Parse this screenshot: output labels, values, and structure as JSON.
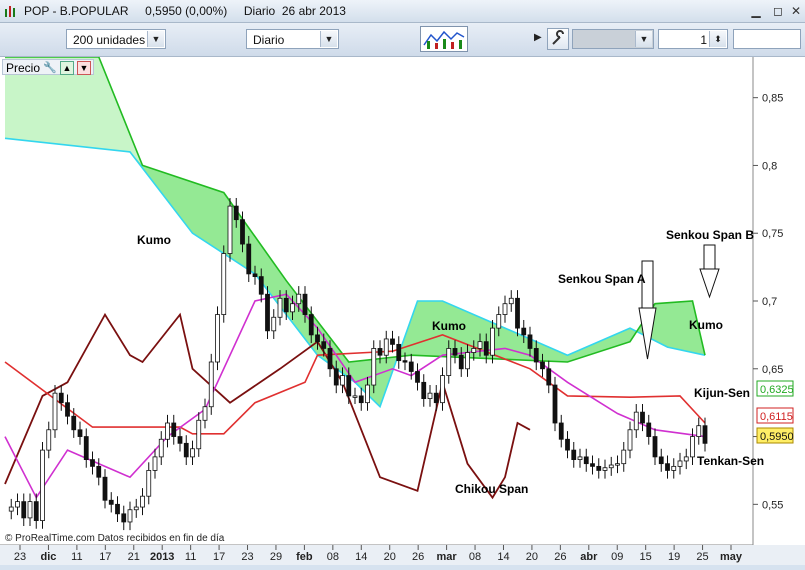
{
  "window": {
    "title": "POP - B.POPULAR     0,5950 (0,00%)     Diario  26 abr 2013",
    "minimize_glyph": "▁",
    "restore_glyph": "◻",
    "close_glyph": "✕"
  },
  "toolbar": {
    "units_select": "200 unidades",
    "period_select": "Diario",
    "panel_toggle_glyph": "▶",
    "spin_value": "1"
  },
  "panel": {
    "label": "Precio"
  },
  "chart": {
    "footer": "© ProRealTime.com  Datos recibidos en fin de día",
    "y_ticks": [
      "0,85",
      "0,8",
      "0,75",
      "0,7",
      "0,65",
      "0,6",
      "0,55"
    ],
    "x_ticks": [
      "23",
      "dic",
      "11",
      "17",
      "21",
      "2013",
      "11",
      "17",
      "23",
      "29",
      "feb",
      "08",
      "14",
      "20",
      "26",
      "mar",
      "08",
      "14",
      "20",
      "26",
      "abr",
      "09",
      "15",
      "19",
      "25",
      "may"
    ],
    "price_tags": [
      "0,6325",
      "0,6115",
      "0,5950"
    ],
    "annotations": {
      "kumo1": "Kumo",
      "kumo2": "Kumo",
      "kumo3": "Kumo",
      "senkou_a": "Senkou Span A",
      "senkou_b": "Senkou Span B",
      "kijun": "Kijun-Sen",
      "tenkan": "Tenkan-Sen",
      "chikou": "Chikou Span"
    }
  },
  "colors": {
    "kumo_fill": "#66e066",
    "kumo_light": "#c8f5c8",
    "cyan_line": "#33d6ee",
    "kumo_cyan_fill": "#a8eef7",
    "kijun": "#e03030",
    "tenkan": "#d030d0",
    "chikou": "#7a1010",
    "senkou_b_line": "#22bb22"
  },
  "chart_data": {
    "type": "candlestick",
    "ylim": [
      0.52,
      0.88
    ],
    "price": [
      0.545,
      0.548,
      0.552,
      0.54,
      0.552,
      0.538,
      0.59,
      0.605,
      0.632,
      0.625,
      0.615,
      0.605,
      0.6,
      0.583,
      0.578,
      0.57,
      0.553,
      0.55,
      0.543,
      0.537,
      0.546,
      0.548,
      0.556,
      0.575,
      0.585,
      0.598,
      0.61,
      0.6,
      0.595,
      0.585,
      0.591,
      0.612,
      0.622,
      0.655,
      0.69,
      0.735,
      0.77,
      0.76,
      0.742,
      0.72,
      0.718,
      0.705,
      0.678,
      0.688,
      0.702,
      0.692,
      0.698,
      0.705,
      0.69,
      0.675,
      0.67,
      0.665,
      0.65,
      0.638,
      0.645,
      0.63,
      0.63,
      0.625,
      0.638,
      0.665,
      0.66,
      0.672,
      0.668,
      0.656,
      0.655,
      0.648,
      0.64,
      0.628,
      0.632,
      0.625,
      0.645,
      0.665,
      0.66,
      0.65,
      0.662,
      0.665,
      0.67,
      0.66,
      0.68,
      0.69,
      0.698,
      0.702,
      0.68,
      0.675,
      0.665,
      0.655,
      0.65,
      0.638,
      0.61,
      0.598,
      0.59,
      0.583,
      0.585,
      0.58,
      0.578,
      0.575,
      0.577,
      0.579,
      0.58,
      0.59,
      0.605,
      0.618,
      0.61,
      0.6,
      0.585,
      0.58,
      0.575,
      0.578,
      0.582,
      0.585,
      0.6,
      0.608,
      0.595
    ],
    "kijun": [
      [
        0,
        0.655
      ],
      [
        14,
        0.607
      ],
      [
        28,
        0.607
      ],
      [
        30,
        0.602
      ],
      [
        35,
        0.602
      ],
      [
        40,
        0.625
      ],
      [
        48,
        0.64
      ],
      [
        50,
        0.66
      ],
      [
        62,
        0.663
      ],
      [
        70,
        0.675
      ],
      [
        84,
        0.65
      ],
      [
        90,
        0.63
      ],
      [
        100,
        0.629
      ],
      [
        108,
        0.63
      ],
      [
        112,
        0.61
      ]
    ],
    "tenkan": [
      [
        0,
        0.6
      ],
      [
        5,
        0.555
      ],
      [
        10,
        0.59
      ],
      [
        20,
        0.57
      ],
      [
        26,
        0.6
      ],
      [
        32,
        0.62
      ],
      [
        40,
        0.7
      ],
      [
        45,
        0.705
      ],
      [
        50,
        0.68
      ],
      [
        56,
        0.64
      ],
      [
        62,
        0.65
      ],
      [
        65,
        0.645
      ],
      [
        70,
        0.66
      ],
      [
        80,
        0.665
      ],
      [
        84,
        0.66
      ],
      [
        90,
        0.64
      ],
      [
        98,
        0.617
      ],
      [
        104,
        0.605
      ],
      [
        112,
        0.6
      ]
    ],
    "chikou": [
      [
        0,
        0.565
      ],
      [
        6,
        0.63
      ],
      [
        10,
        0.64
      ],
      [
        16,
        0.69
      ],
      [
        20,
        0.66
      ],
      [
        22,
        0.655
      ],
      [
        28,
        0.69
      ],
      [
        30,
        0.65
      ],
      [
        36,
        0.625
      ],
      [
        44,
        0.65
      ],
      [
        50,
        0.67
      ],
      [
        54,
        0.64
      ],
      [
        60,
        0.57
      ],
      [
        66,
        0.56
      ],
      [
        70,
        0.64
      ],
      [
        74,
        0.58
      ],
      [
        78,
        0.555
      ],
      [
        80,
        0.57
      ],
      [
        82,
        0.61
      ],
      [
        84,
        0.605
      ]
    ],
    "senkou_a": [
      [
        0,
        0.82
      ],
      [
        20,
        0.81
      ],
      [
        30,
        0.75
      ],
      [
        40,
        0.72
      ],
      [
        50,
        0.66
      ],
      [
        56,
        0.64
      ],
      [
        60,
        0.622
      ],
      [
        66,
        0.7
      ],
      [
        70,
        0.7
      ],
      [
        80,
        0.68
      ],
      [
        90,
        0.66
      ],
      [
        100,
        0.68
      ],
      [
        106,
        0.666
      ],
      [
        112,
        0.66
      ]
    ],
    "senkou_b": [
      [
        0,
        0.88
      ],
      [
        15,
        0.88
      ],
      [
        22,
        0.8
      ],
      [
        35,
        0.78
      ],
      [
        45,
        0.715
      ],
      [
        55,
        0.655
      ],
      [
        65,
        0.66
      ],
      [
        90,
        0.655
      ],
      [
        100,
        0.67
      ],
      [
        104,
        0.698
      ],
      [
        110,
        0.7
      ],
      [
        112,
        0.66
      ]
    ]
  }
}
